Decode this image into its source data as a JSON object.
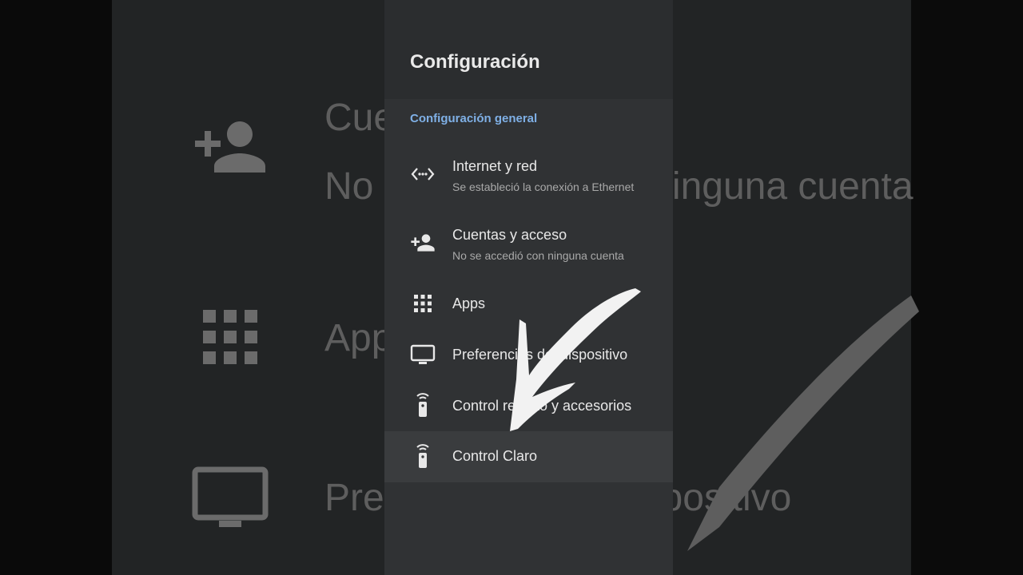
{
  "settings": {
    "title": "Configuración",
    "section_label": "Configuración general",
    "items": [
      {
        "title": "Internet y red",
        "subtitle": "Se estableció la conexión a Ethernet",
        "icon": "network-icon"
      },
      {
        "title": "Cuentas y acceso",
        "subtitle": "No se accedió con ninguna cuenta",
        "icon": "add-person-icon"
      },
      {
        "title": "Apps",
        "icon": "apps-grid-icon"
      },
      {
        "title": "Preferencias del dispositivo",
        "icon": "tv-icon"
      },
      {
        "title": "Control remoto y accesorios",
        "icon": "remote-icon"
      },
      {
        "title": "Control Claro",
        "icon": "remote-icon",
        "selected": true
      }
    ]
  },
  "background": {
    "texts": [
      {
        "text": "Cuentas y acceso"
      },
      {
        "text": "No se accedió con ninguna cuenta"
      },
      {
        "text": "Apps"
      },
      {
        "text": "Preferencias del dispositivo"
      }
    ]
  },
  "colors": {
    "panel_bg": "#303234",
    "header_bg": "#2b2d2f",
    "accent": "#7fb0e6",
    "selected_bg": "#3a3c3e"
  }
}
